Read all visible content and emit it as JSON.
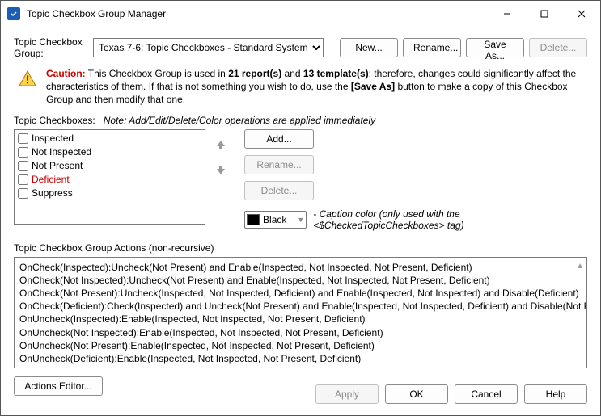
{
  "window": {
    "title": "Topic Checkbox Group Manager"
  },
  "topRow": {
    "label": "Topic Checkbox Group:",
    "selected": "Texas 7-6: Topic Checkboxes - Standard System",
    "buttons": {
      "new": "New...",
      "rename": "Rename...",
      "saveAs": "Save As...",
      "delete": "Delete..."
    }
  },
  "caution": {
    "prefix": "Caution:",
    "part1": " This Checkbox Group is used in ",
    "reports": "21 report(s)",
    "part2": " and ",
    "templates": "13 template(s)",
    "part3": "; therefore, changes could significantly affect the characteristics of them. If that is not something you wish to do, use the ",
    "saveAs": "[Save As]",
    "part4": " button to make a copy of this Checkbox Group and then modify that one."
  },
  "checkboxes": {
    "label": "Topic Checkboxes:",
    "note": "Note: Add/Edit/Delete/Color operations are applied immediately",
    "items": [
      {
        "label": "Inspected",
        "red": false
      },
      {
        "label": "Not Inspected",
        "red": false
      },
      {
        "label": "Not Present",
        "red": false
      },
      {
        "label": "Deficient",
        "red": true
      },
      {
        "label": "Suppress",
        "red": false
      }
    ],
    "sideButtons": {
      "add": "Add...",
      "rename": "Rename...",
      "delete": "Delete..."
    }
  },
  "color": {
    "name": "Black",
    "hex": "#000000",
    "note": "- Caption color (only used with the <$CheckedTopicCheckboxes> tag)"
  },
  "actions": {
    "label": "Topic Checkbox Group Actions (non-recursive)",
    "lines": [
      "OnCheck(Inspected):Uncheck(Not Present) and Enable(Inspected, Not Inspected, Not Present, Deficient)",
      "OnCheck(Not Inspected):Uncheck(Not Present) and Enable(Inspected, Not Inspected, Not Present, Deficient)",
      "OnCheck(Not Present):Uncheck(Inspected, Not Inspected, Deficient) and Enable(Inspected, Not Inspected) and Disable(Deficient)",
      "OnCheck(Deficient):Check(Inspected) and Uncheck(Not Present) and Enable(Inspected, Not Inspected, Deficient) and Disable(Not Present)",
      "OnUncheck(Inspected):Enable(Inspected, Not Inspected, Not Present, Deficient)",
      "OnUncheck(Not Inspected):Enable(Inspected, Not Inspected, Not Present, Deficient)",
      "OnUncheck(Not Present):Enable(Inspected, Not Inspected, Not Present, Deficient)",
      "OnUncheck(Deficient):Enable(Inspected, Not Inspected, Not Present, Deficient)"
    ],
    "editorButton": "Actions Editor..."
  },
  "footer": {
    "apply": "Apply",
    "ok": "OK",
    "cancel": "Cancel",
    "help": "Help"
  }
}
